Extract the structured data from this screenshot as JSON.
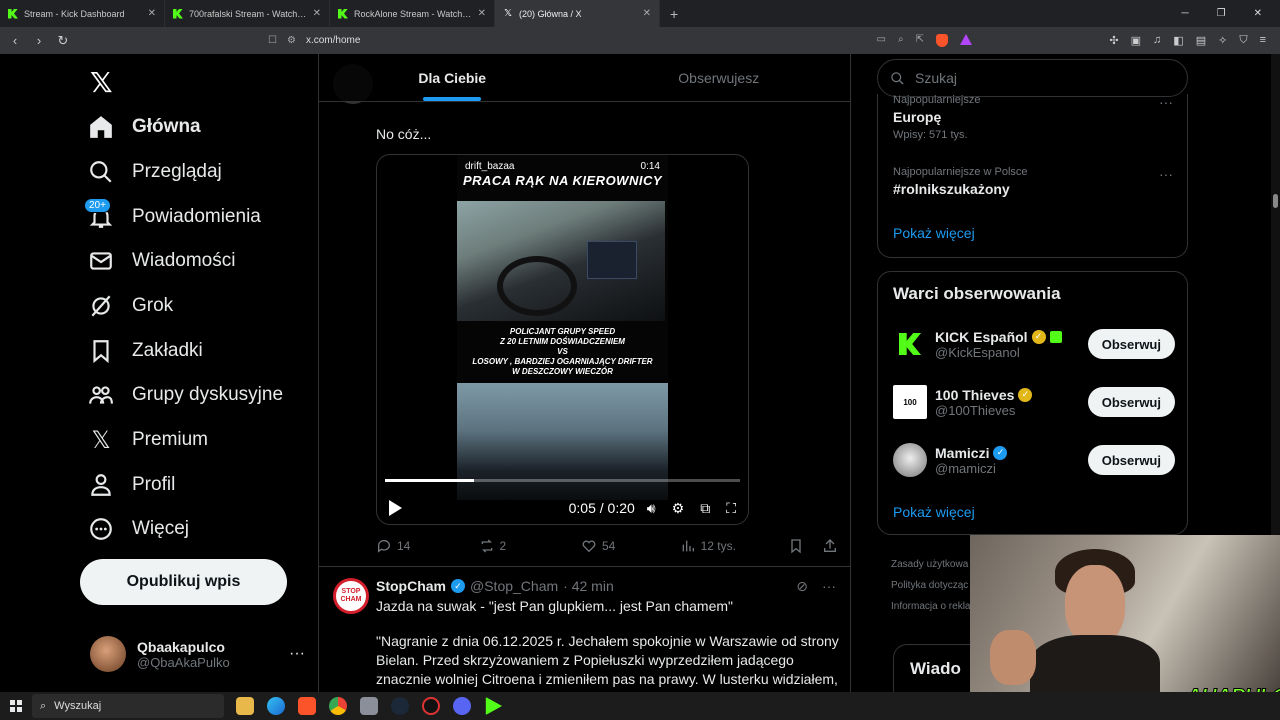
{
  "browser": {
    "tabs": [
      {
        "title": "Stream - Kick Dashboard",
        "icon": "kick"
      },
      {
        "title": "700rafalski Stream - Watch Live o",
        "icon": "kick"
      },
      {
        "title": "RockAlone Stream - Watch Live on Ki",
        "icon": "kick"
      },
      {
        "title": "(20) Główna / X",
        "icon": "x",
        "active": true
      }
    ],
    "url": "x.com/home"
  },
  "sidebar": {
    "items": [
      {
        "label": "Główna",
        "icon": "home-icon"
      },
      {
        "label": "Przeglądaj",
        "icon": "search-icon"
      },
      {
        "label": "Powiadomienia",
        "icon": "bell-icon",
        "badge": "20+"
      },
      {
        "label": "Wiadomości",
        "icon": "mail-icon"
      },
      {
        "label": "Grok",
        "icon": "grok-icon"
      },
      {
        "label": "Zakładki",
        "icon": "bookmark-icon"
      },
      {
        "label": "Grupy dyskusyjne",
        "icon": "people-icon"
      },
      {
        "label": "Premium",
        "icon": "x-icon"
      },
      {
        "label": "Profil",
        "icon": "person-icon"
      },
      {
        "label": "Więcej",
        "icon": "more-icon"
      }
    ],
    "post_button": "Opublikuj wpis",
    "user": {
      "name": "Qbaakapulco",
      "handle": "@QbaAkaPulko"
    }
  },
  "feed": {
    "tabs": [
      "Dla Ciebie",
      "Obserwujesz"
    ],
    "tweet1": {
      "text": "No cóż...",
      "video": {
        "username": "drift_bazaa",
        "duration": "0:14",
        "title": "PRACA RĄK NA KIEROWNICY",
        "caption": [
          "POLICJANT GRUPY SPEED",
          "Z 20 LETNIM DOŚWIADCZENIEM",
          "VS",
          "LOSOWY , BARDZIEJ OGARNIAJĄCY DRIFTER",
          "W DESZCZOWY WIECZÓR"
        ],
        "time": "0:05 / 0:20",
        "progress": 0.25
      },
      "stats": {
        "replies": "14",
        "reposts": "2",
        "likes": "54",
        "views": "12 tys."
      }
    },
    "tweet2": {
      "name": "StopCham",
      "handle": "@Stop_Cham",
      "time": "· 42 min",
      "avatar_text": "STOP CHAM",
      "title": "Jazda na suwak - \"jest Pan glupkiem... jest Pan chamem\"",
      "body": "\"Nagranie z dnia 06.12.2025 r. Jechałem spokojnie w Warszawie od strony Bielan. Przed skrzyżowaniem z Popiełuszki wyprzedziłem jadącego znacznie wolniej Citroena i zmieniłem pas na prawy. W lusterku widziałem, że kierowca"
    }
  },
  "right": {
    "search_placeholder": "Szukaj",
    "trends": [
      {
        "category": "Najpopularniejsze",
        "title": "Europę",
        "count": "Wpisy: 571 tys."
      },
      {
        "category": "Najpopularniejsze w Polsce",
        "title": "#rolnikszukażony",
        "count": ""
      }
    ],
    "trends_more": "Pokaż więcej",
    "who_title": "Warci obserwowania",
    "who": [
      {
        "name": "KICK Español",
        "handle": "@KickEspanol",
        "badge": "gold"
      },
      {
        "name": "100 Thieves",
        "handle": "@100Thieves",
        "badge": "gold"
      },
      {
        "name": "Mamiczi",
        "handle": "@mamiczi",
        "badge": "blue"
      }
    ],
    "follow_label": "Obserwuj",
    "who_more": "Pokaż więcej",
    "footer": [
      "Zasady użytkowa",
      "Polityka dotycząc",
      "Informacja o rekla"
    ],
    "news_title": "Wiado"
  },
  "overlay": {
    "logo": "AHAPULCO"
  },
  "taskbar": {
    "search": "Wyszukaj"
  },
  "colors": {
    "accent": "#1d9bf0",
    "kick": "#53fc18",
    "background": "#000000"
  }
}
